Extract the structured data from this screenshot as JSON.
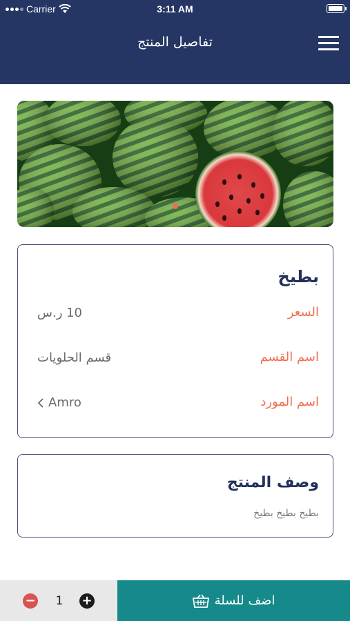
{
  "status_bar": {
    "carrier": "Carrier",
    "time": "3:11 AM"
  },
  "header": {
    "title": "تفاصيل المنتج",
    "menu_icon": "hamburger-menu-icon"
  },
  "banner": {
    "image": "watermelons-photo",
    "active_slide": 1,
    "slide_count": 1
  },
  "product": {
    "name": "بطيخ",
    "price_label": "السعر",
    "price_value": "10 ر.س",
    "category_label": "اسم القسم",
    "category_value": "قسم الحلويات",
    "supplier_label": "اسم المورد",
    "supplier_value": "Amro"
  },
  "description": {
    "title": "وصف المنتج",
    "text": "بطيخ بطيخ بطيخ"
  },
  "bottom": {
    "quantity": "1",
    "minus_icon": "minus-circle-icon",
    "plus_icon": "plus-circle-icon",
    "add_to_cart_label": "اضف للسلة",
    "cart_icon": "basket-icon"
  },
  "colors": {
    "header": "#263664",
    "accent_label": "#f06d4f",
    "cart_button": "#168a8a",
    "minus": "#d9534f"
  }
}
